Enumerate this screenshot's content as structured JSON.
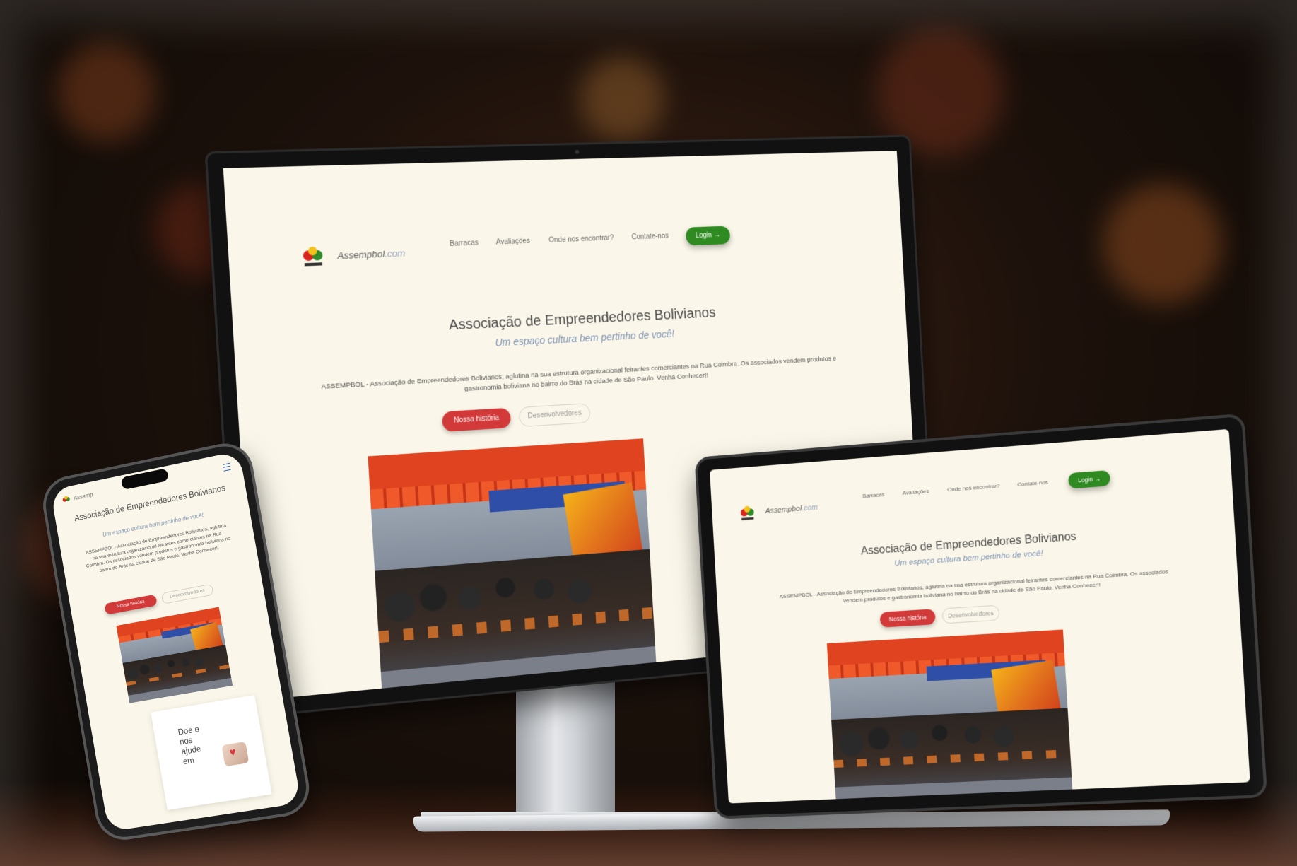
{
  "site": {
    "brand_name": "Assempbol",
    "brand_tld": ".com",
    "nav": [
      "Barracas",
      "Avaliações",
      "Onde nos encontrar?",
      "Contate-nos"
    ],
    "login_label": "Login →",
    "title": "Associação de Empreendedores Bolivianos",
    "subtitle": "Um espaço cultura bem pertinho de você!",
    "description": "ASSEMPBOL - Associação de Empreendedores Bolivianos, aglutina na sua estrutura organizacional feirantes comerciantes na Rua Coimbra. Os associados vendem produtos e gastronomia boliviana no bairro do Brás na cidade de São Paulo. Venha Conhecer!!",
    "primary_button": "Nossa história",
    "secondary_button": "Desenvolvedores",
    "logo_icon": "assempbol-logo-icon",
    "phone_brand_partial": "Assemp",
    "phone_card_text": "Doe e nos ajude em",
    "photo_alt_icon": "group-photo-image"
  },
  "colors": {
    "page_bg": "#faf6e9",
    "login_green": "#2f8a22",
    "primary_red": "#d23a3a",
    "subtitle_blue": "#7d94b5"
  }
}
